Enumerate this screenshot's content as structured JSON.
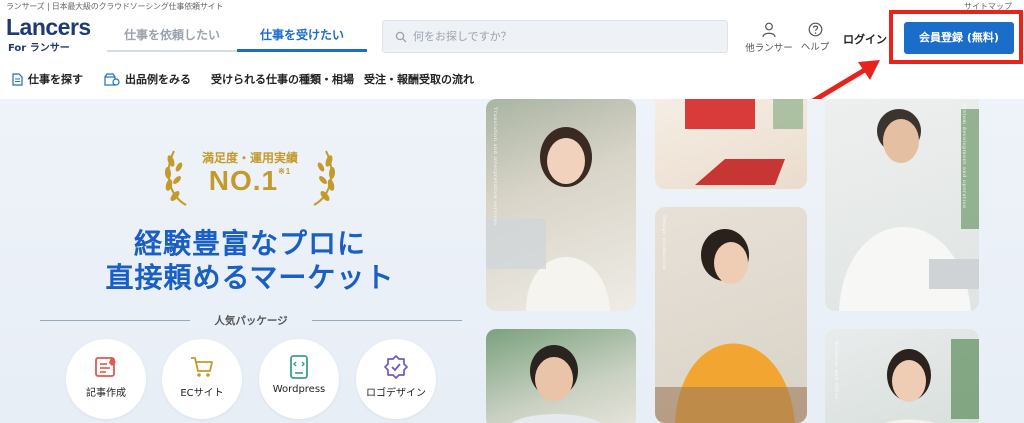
{
  "top": {
    "tagline": "ランサーズ | 日本最大級のクラウドソーシング仕事依頼サイト",
    "sitemap": "サイトマップ"
  },
  "header": {
    "logo_text": "Lancers",
    "logo_sub": "For ランサー",
    "tab_request": "仕事を依頼したい",
    "tab_work": "仕事を受けたい",
    "search_placeholder": "何をお探しですか？",
    "others_label": "他ランサー",
    "help_label": "ヘルプ",
    "login_label": "ログイン",
    "signup_label": "会員登録 (無料)"
  },
  "nav": {
    "items": [
      {
        "label": "仕事を探す",
        "icon": "document-icon"
      },
      {
        "label": "出品例をみる",
        "icon": "shop-icon"
      },
      {
        "label": "受けられる仕事の種類・相場",
        "icon": ""
      },
      {
        "label": "受注・報酬受取の流れ",
        "icon": ""
      }
    ]
  },
  "hero": {
    "award_sub": "満足度・運用実績",
    "award_main": "NO.1",
    "award_note": "※1",
    "headline_line1": "経験豊富なプロに",
    "headline_line2": "直接頼めるマーケット",
    "packages_title": "人気パッケージ",
    "packages": [
      {
        "label": "記事作成",
        "icon": "article-icon"
      },
      {
        "label": "ECサイト",
        "icon": "cart-icon"
      },
      {
        "label": "Wordpress",
        "icon": "code-tablet-icon"
      },
      {
        "label": "ロゴデザイン",
        "icon": "badge-check-icon"
      }
    ],
    "photo_captions": [
      "Translation and interpretation services",
      "Design production",
      "System development and operation",
      "Business and office"
    ]
  },
  "colors": {
    "brand_blue": "#1a6dc9",
    "headline_blue": "#1a5fc4",
    "gold": "#c49a2c",
    "highlight_red": "#e8231c",
    "logo_navy": "#1f3a70"
  }
}
